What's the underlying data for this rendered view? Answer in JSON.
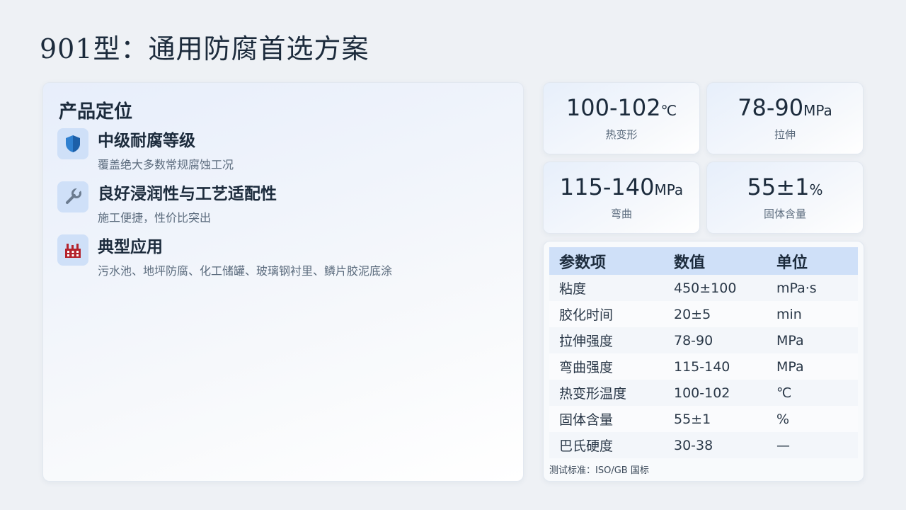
{
  "title": "901型：通用防腐首选方案",
  "positioning": {
    "heading": "产品定位",
    "features": [
      {
        "icon": "shield-icon",
        "title": "中级耐腐等级",
        "desc": "覆盖绝大多数常规腐蚀工况"
      },
      {
        "icon": "wrench-icon",
        "title": "良好浸润性与工艺适配性",
        "desc": "施工便捷，性价比突出"
      },
      {
        "icon": "factory-icon",
        "title": "典型应用",
        "desc": "污水池、地坪防腐、化工储罐、玻璃钢衬里、鳞片胶泥底涂"
      }
    ]
  },
  "stats": [
    {
      "value": "100-102",
      "unit": "℃",
      "label": "热变形"
    },
    {
      "value": "78-90",
      "unit": "MPa",
      "label": "拉伸"
    },
    {
      "value": "115-140",
      "unit": "MPa",
      "label": "弯曲"
    },
    {
      "value": "55±1",
      "unit": "%",
      "label": "固体含量"
    }
  ],
  "table": {
    "headers": [
      "参数项",
      "数值",
      "单位"
    ],
    "rows": [
      [
        "粘度",
        "450±100",
        "mPa·s"
      ],
      [
        "胶化时间",
        "20±5",
        "min"
      ],
      [
        "拉伸强度",
        "78-90",
        "MPa"
      ],
      [
        "弯曲强度",
        "115-140",
        "MPa"
      ],
      [
        "热变形温度",
        "100-102",
        "℃"
      ],
      [
        "固体含量",
        "55±1",
        "%"
      ],
      [
        "巴氏硬度",
        "30-38",
        "—"
      ]
    ],
    "note": "测试标准：ISO/GB 国标"
  },
  "colors": {
    "accent": "#cfe0f8",
    "shield": "#2f80d0",
    "factory": "#b4232d"
  }
}
